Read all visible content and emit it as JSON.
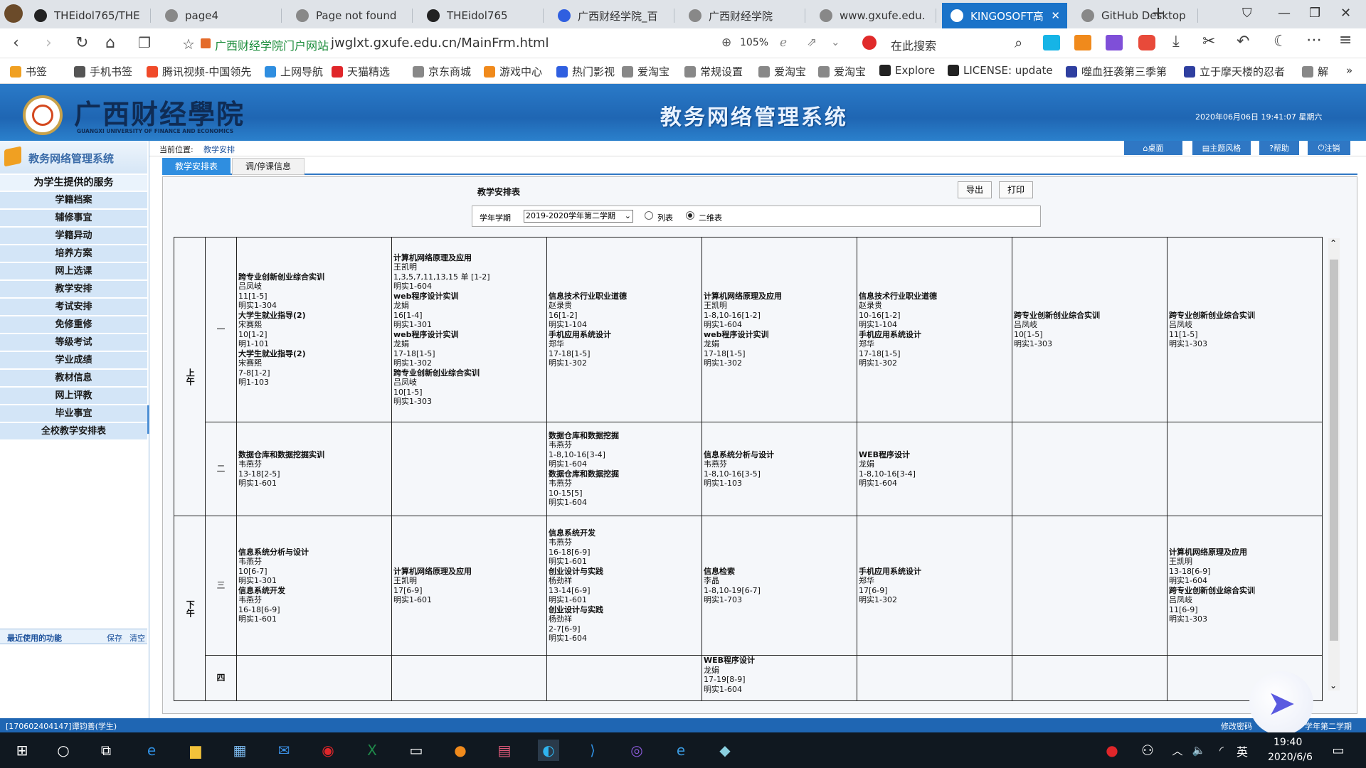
{
  "browser": {
    "tabs": [
      {
        "label": "THEidol765/THE",
        "icon": "github-icon"
      },
      {
        "label": "page4",
        "icon": "globe-icon"
      },
      {
        "label": "Page not found",
        "icon": "globe-icon"
      },
      {
        "label": "THEidol765",
        "icon": "github-icon"
      },
      {
        "label": "广西财经学院_百",
        "icon": "baidu-icon"
      },
      {
        "label": "广西财经学院",
        "icon": "globe-icon"
      },
      {
        "label": "www.gxufe.edu.",
        "icon": "globe-icon"
      },
      {
        "label": "KINGOSOFT高",
        "icon": "globe-icon",
        "active": true
      },
      {
        "label": "GitHub Desktop",
        "icon": "globe-icon"
      }
    ],
    "site_name": "广西财经学院门户网站",
    "url": "jwglxt.gxufe.edu.cn/MainFrm.html",
    "zoom": "105%",
    "search_placeholder": "在此搜索",
    "bookmarks": [
      "书签",
      "手机书签",
      "腾讯视频-中国领先",
      "上网导航",
      "天猫精选",
      "京东商城",
      "游戏中心",
      "热门影视",
      "爱淘宝",
      "常规设置",
      "爱淘宝",
      "爱淘宝",
      "Explore",
      "LICENSE: update",
      "噬血狂袭第三季第",
      "立于摩天楼的忍者",
      "解"
    ]
  },
  "header": {
    "logo_cn": "广西财经學院",
    "logo_en": "GUANGXI UNIVERSITY OF FINANCE AND ECONOMICS",
    "system_title": "教务网络管理系统",
    "datetime": "2020年06月06日  19:41:07  星期六"
  },
  "sidebar": {
    "title": "教务网络管理系统",
    "section": "为学生提供的服务",
    "items": [
      "学籍档案",
      "辅修事宜",
      "学籍异动",
      "培养方案",
      "网上选课",
      "教学安排",
      "考试安排",
      "免修重修",
      "等级考试",
      "学业成绩",
      "教材信息",
      "网上评教",
      "毕业事宜",
      "全校教学安排表"
    ],
    "recent_label": "最近使用的功能",
    "save": "保存",
    "clear": "清空"
  },
  "topnav": {
    "location_label": "当前位置:",
    "location": "教学安排",
    "desktop": "桌面",
    "theme": "主题风格",
    "help": "帮助",
    "logout": "注销"
  },
  "subtabs": [
    "教学安排表",
    "调/停课信息"
  ],
  "panel": {
    "title": "教学安排表",
    "export": "导出",
    "print": "打印",
    "term_label": "学年学期",
    "term_value": "2019-2020学年第二学期",
    "radio_list": "列表",
    "radio_grid": "二维表"
  },
  "timetable": {
    "halves": [
      "上午",
      "下午"
    ],
    "periods": [
      "一",
      "二",
      "三",
      "四"
    ],
    "cells": [
      [
        [
          {
            "n": "跨专业创新创业综合实训",
            "t": "吕凤岐",
            "w": "11[1-5]",
            "r": "明实1-304"
          },
          {
            "n": "大学生就业指导(2)",
            "t": "宋赛熙",
            "w": "10[1-2]",
            "r": "明1-101"
          },
          {
            "n": "大学生就业指导(2)",
            "t": "宋赛熙",
            "w": "7-8[1-2]",
            "r": "明1-103"
          }
        ],
        [
          {
            "n": "计算机网络原理及应用",
            "t": "王凯明",
            "w": "1,3,5,7,11,13,15 单 [1-2]",
            "r": "明实1-604"
          },
          {
            "n": "web程序设计实训",
            "t": "龙娟",
            "w": "16[1-4]",
            "r": "明实1-301"
          },
          {
            "n": "web程序设计实训",
            "t": "龙娟",
            "w": "17-18[1-5]",
            "r": "明实1-302"
          },
          {
            "n": "跨专业创新创业综合实训",
            "t": "吕凤岐",
            "w": "10[1-5]",
            "r": "明实1-303"
          }
        ],
        [
          {
            "n": "信息技术行业职业道德",
            "t": "赵录贵",
            "w": "16[1-2]",
            "r": "明实1-104"
          },
          {
            "n": "手机应用系统设计",
            "t": "郑华",
            "w": "17-18[1-5]",
            "r": "明实1-302"
          }
        ],
        [
          {
            "n": "计算机网络原理及应用",
            "t": "王凯明",
            "w": "1-8,10-16[1-2]",
            "r": "明实1-604"
          },
          {
            "n": "web程序设计实训",
            "t": "龙娟",
            "w": "17-18[1-5]",
            "r": "明实1-302"
          }
        ],
        [
          {
            "n": "信息技术行业职业道德",
            "t": "赵录贵",
            "w": "10-16[1-2]",
            "r": "明实1-104"
          },
          {
            "n": "手机应用系统设计",
            "t": "郑华",
            "w": "17-18[1-5]",
            "r": "明实1-302"
          }
        ],
        [
          {
            "n": "跨专业创新创业综合实训",
            "t": "吕凤岐",
            "w": "10[1-5]",
            "r": "明实1-303"
          }
        ],
        [
          {
            "n": "跨专业创新创业综合实训",
            "t": "吕凤岐",
            "w": "11[1-5]",
            "r": "明实1-303"
          }
        ]
      ],
      [
        [
          {
            "n": "数据仓库和数据挖掘实训",
            "t": "韦燕芬",
            "w": "13-18[2-5]",
            "r": "明实1-601"
          }
        ],
        [],
        [
          {
            "n": "数据仓库和数据挖掘",
            "t": "韦燕芬",
            "w": "1-8,10-16[3-4]",
            "r": "明实1-604"
          },
          {
            "n": "数据仓库和数据挖掘",
            "t": "韦燕芬",
            "w": "10-15[5]",
            "r": "明实1-604"
          }
        ],
        [
          {
            "n": "信息系统分析与设计",
            "t": "韦燕芬",
            "w": "1-8,10-16[3-5]",
            "r": "明实1-103"
          }
        ],
        [
          {
            "n": "WEB程序设计",
            "t": "龙娟",
            "w": "1-8,10-16[3-4]",
            "r": "明实1-604"
          }
        ],
        [],
        []
      ],
      [
        [
          {
            "n": "信息系统分析与设计",
            "t": "韦燕芬",
            "w": "10[6-7]",
            "r": "明实1-301"
          },
          {
            "n": "信息系统开发",
            "t": "韦燕芬",
            "w": "16-18[6-9]",
            "r": "明实1-601"
          }
        ],
        [
          {
            "n": "计算机网络原理及应用",
            "t": "王凯明",
            "w": "17[6-9]",
            "r": "明实1-601"
          }
        ],
        [
          {
            "n": "信息系统开发",
            "t": "韦燕芬",
            "w": "16-18[6-9]",
            "r": "明实1-601"
          },
          {
            "n": "创业设计与实践",
            "t": "杨劲祥",
            "w": "13-14[6-9]",
            "r": "明实1-601"
          },
          {
            "n": "创业设计与实践",
            "t": "杨劲祥",
            "w": "2-7[6-9]",
            "r": "明实1-604"
          }
        ],
        [
          {
            "n": "信息检索",
            "t": "李晶",
            "w": "1-8,10-19[6-7]",
            "r": "明实1-703"
          }
        ],
        [
          {
            "n": "手机应用系统设计",
            "t": "郑华",
            "w": "17[6-9]",
            "r": "明实1-302"
          }
        ],
        [],
        [
          {
            "n": "计算机网络原理及应用",
            "t": "王凯明",
            "w": "13-18[6-9]",
            "r": "明实1-604"
          },
          {
            "n": "跨专业创新创业综合实训",
            "t": "吕凤岐",
            "w": "11[6-9]",
            "r": "明实1-303"
          }
        ]
      ],
      [
        [],
        [],
        [],
        [
          {
            "n": "WEB程序设计",
            "t": "龙娟",
            "w": "17-19[8-9]",
            "r": "明实1-604"
          }
        ],
        [],
        [],
        []
      ]
    ]
  },
  "status": {
    "user": "[170602404147]谭钧善(学生)",
    "right_link": "修改密码",
    "right_term": "学年第二学期"
  },
  "taskbar": {
    "time": "19:40",
    "date": "2020/6/6",
    "ime": "英"
  },
  "colors": {
    "header_blue": "#1f66b3",
    "tab_active": "#1a73c9",
    "sidebar_item": "#d3e5f7"
  }
}
